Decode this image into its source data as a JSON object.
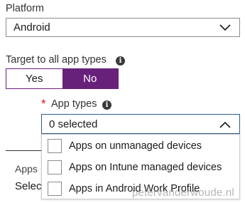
{
  "platform": {
    "label": "Platform",
    "value": "Android"
  },
  "target": {
    "label": "Target to all app types",
    "info_icon": "info-icon",
    "options": [
      "Yes",
      "No"
    ],
    "selected": "No"
  },
  "app_types": {
    "required_marker": "*",
    "label": "App types",
    "info_icon": "info-icon",
    "value": "0 selected",
    "expanded": true,
    "options": [
      {
        "label": "Apps on unmanaged devices",
        "checked": false
      },
      {
        "label": "Apps on Intune managed devices",
        "checked": false
      },
      {
        "label": "Apps in Android Work Profile",
        "checked": false
      }
    ]
  },
  "background": {
    "partial_label": "Apps",
    "partial_value": "Selec"
  },
  "watermark": "petervanderwoude.nl",
  "colors": {
    "accent": "#68217a",
    "required": "#dd1111",
    "focus_border": "#2d5f8a"
  }
}
